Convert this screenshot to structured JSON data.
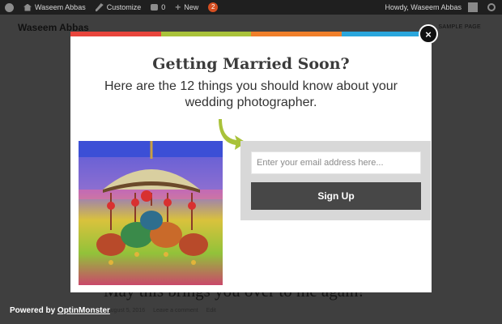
{
  "admin_bar": {
    "site_name": "Waseem Abbas",
    "customize_label": "Customize",
    "comments_count": "0",
    "new_label": "New",
    "updates_badge": "2",
    "greeting": "Howdy, Waseem Abbas"
  },
  "site": {
    "title": "Waseem Abbas",
    "nav_link": "SAMPLE PAGE"
  },
  "post": {
    "title": "May this brings you over to me again!",
    "date": "August 5, 2016",
    "comment_link": "Leave a comment",
    "edit_link": "Edit"
  },
  "popup": {
    "stripe_colors": [
      "#e8453c",
      "#a9c23a",
      "#f07f2a",
      "#2aa6dc"
    ],
    "close_glyph": "×",
    "headline": "Getting Married Soon?",
    "subhead": "Here are the 12 things you should know about your wedding photographer.",
    "arrow_color": "#a9c23a",
    "email_placeholder": "Enter your email address here...",
    "email_value": "",
    "signup_label": "Sign Up"
  },
  "footer": {
    "powered_prefix": "Powered by",
    "powered_link": "OptinMonster"
  }
}
